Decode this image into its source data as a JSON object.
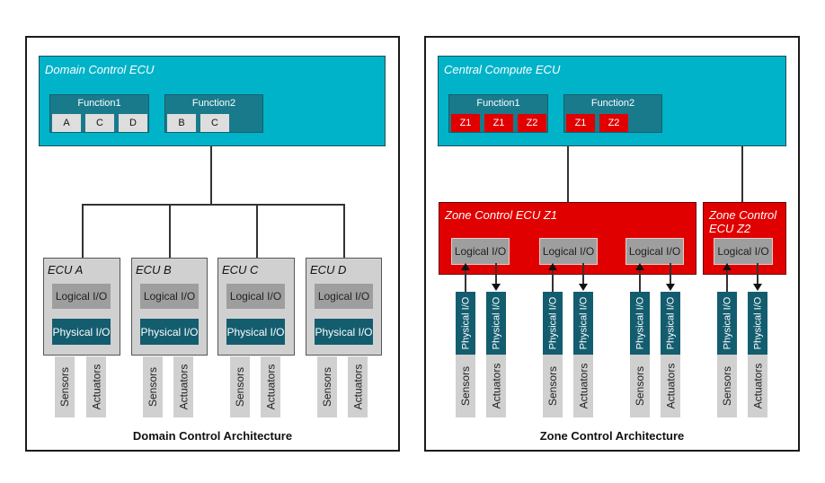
{
  "domain_panel": {
    "ecu_title": "Domain Control ECU",
    "functions": [
      {
        "label": "Function1",
        "cells": [
          "A",
          "C",
          "D"
        ]
      },
      {
        "label": "Function2",
        "cells": [
          "B",
          "C"
        ]
      }
    ],
    "ecus": [
      {
        "title": "ECU A",
        "logical": "Logical I/O",
        "physical": "Physical I/O",
        "sensors": "Sensors",
        "actuators": "Actuators"
      },
      {
        "title": "ECU B",
        "logical": "Logical I/O",
        "physical": "Physical I/O",
        "sensors": "Sensors",
        "actuators": "Actuators"
      },
      {
        "title": "ECU C",
        "logical": "Logical I/O",
        "physical": "Physical I/O",
        "sensors": "Sensors",
        "actuators": "Actuators"
      },
      {
        "title": "ECU D",
        "logical": "Logical I/O",
        "physical": "Physical I/O",
        "sensors": "Sensors",
        "actuators": "Actuators"
      }
    ],
    "caption": "Domain Control Architecture"
  },
  "zone_panel": {
    "ecu_title": "Central Compute ECU",
    "functions": [
      {
        "label": "Function1",
        "cells": [
          "Z1",
          "Z1",
          "Z2"
        ]
      },
      {
        "label": "Function2",
        "cells": [
          "Z1",
          "Z2"
        ]
      }
    ],
    "zone_z1": {
      "title": "Zone Control ECU Z1",
      "logical": [
        "Logical I/O",
        "Logical I/O",
        "Logical I/O"
      ]
    },
    "zone_z2": {
      "title_line1": "Zone Control",
      "title_line2": "ECU Z2",
      "logical": "Logical I/O"
    },
    "physical_label": "Physical I/O",
    "sensors_label": "Sensors",
    "actuators_label": "Actuators",
    "caption": "Zone Control Architecture"
  },
  "colors": {
    "compute": "#00b3c9",
    "function": "#197a8c",
    "physical": "#135d6f",
    "zone": "#e00000",
    "logical": "#9e9e9e",
    "ecu": "#d0d0d0"
  }
}
